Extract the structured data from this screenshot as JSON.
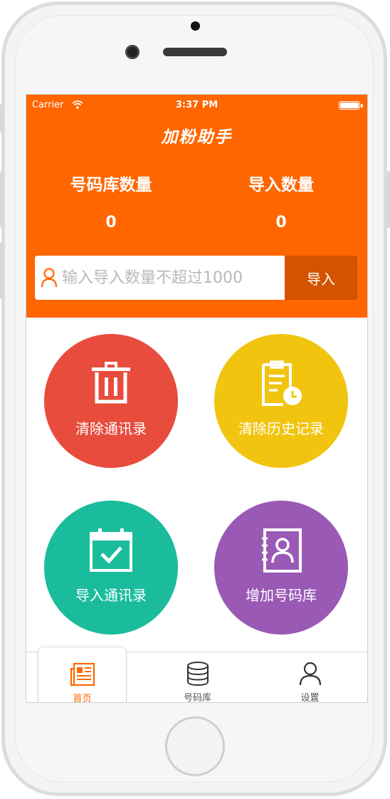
{
  "status_bar": {
    "carrier": "Carrier",
    "time": "3:37 PM"
  },
  "app_title": "加粉助手",
  "stats": {
    "library_label": "号码库数量",
    "library_value": "0",
    "imported_label": "导入数量",
    "imported_value": "0"
  },
  "import_form": {
    "placeholder": "输入导入数量不超过1000",
    "button_label": "导入"
  },
  "actions": [
    {
      "label": "清除通讯录",
      "icon": "trash-icon",
      "color": "#e74c3c"
    },
    {
      "label": "清除历史记录",
      "icon": "history-icon",
      "color": "#f1c40f"
    },
    {
      "label": "导入通讯录",
      "icon": "calendar-check-icon",
      "color": "#1abc9c"
    },
    {
      "label": "增加号码库",
      "icon": "contact-book-icon",
      "color": "#9b59b6"
    }
  ],
  "tabs": [
    {
      "label": "首页",
      "icon": "news-icon",
      "active": true
    },
    {
      "label": "号码库",
      "icon": "database-icon",
      "active": false
    },
    {
      "label": "设置",
      "icon": "user-icon",
      "active": false
    }
  ],
  "colors": {
    "brand": "#ff6600",
    "import_button": "#d25400"
  }
}
